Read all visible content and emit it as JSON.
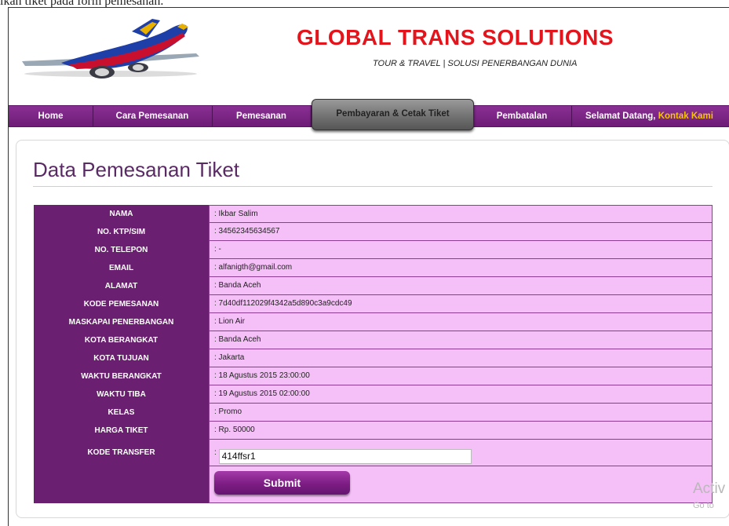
{
  "caption": "ikan tiket pada form pemesanan.",
  "header": {
    "brand_title": "GLOBAL TRANS SOLUTIONS",
    "brand_subtitle": "TOUR & TRAVEL | SOLUSI PENERBANGAN DUNIA"
  },
  "nav": {
    "home": "Home",
    "cara_pemesanan": "Cara Pemesanan",
    "pemesanan": "Pemesanan",
    "pembayaran": "Pembayaran & Cetak Tiket",
    "pembatalan": "Pembatalan",
    "welcome": "Selamat Datang,",
    "contact": "Kontak Kami"
  },
  "page": {
    "title": "Data Pemesanan Tiket"
  },
  "rows": [
    {
      "label": "NAMA",
      "value": ": Ikbar Salim"
    },
    {
      "label": "NO. KTP/SIM",
      "value": ": 34562345634567"
    },
    {
      "label": "NO. TELEPON",
      "value": ": -"
    },
    {
      "label": "EMAIL",
      "value": ": alfanigth@gmail.com"
    },
    {
      "label": "ALAMAT",
      "value": ": Banda Aceh"
    },
    {
      "label": "KODE PEMESANAN",
      "value": ": 7d40df112029f4342a5d890c3a9cdc49"
    },
    {
      "label": "MASKAPAI PENERBANGAN",
      "value": ": Lion Air"
    },
    {
      "label": "KOTA BERANGKAT",
      "value": ": Banda Aceh"
    },
    {
      "label": "KOTA TUJUAN",
      "value": ": Jakarta"
    },
    {
      "label": "WAKTU BERANGKAT",
      "value": ": 18 Agustus 2015 23:00:00"
    },
    {
      "label": "WAKTU TIBA",
      "value": ": 19 Agustus 2015 02:00:00"
    },
    {
      "label": "KELAS",
      "value": ": Promo"
    },
    {
      "label": "HARGA TIKET",
      "value": ": Rp. 50000"
    }
  ],
  "transfer": {
    "label": "KODE TRANSFER",
    "prefix": ":",
    "value": "414ffsr1"
  },
  "submit_label": "Submit",
  "watermark": {
    "line1": "Activ",
    "line2": "Go to"
  },
  "colors": {
    "brand_red": "#e3141b",
    "nav_purple": "#6d1c77",
    "label_purple": "#6b1f70",
    "value_pink": "#f5c0f7"
  }
}
